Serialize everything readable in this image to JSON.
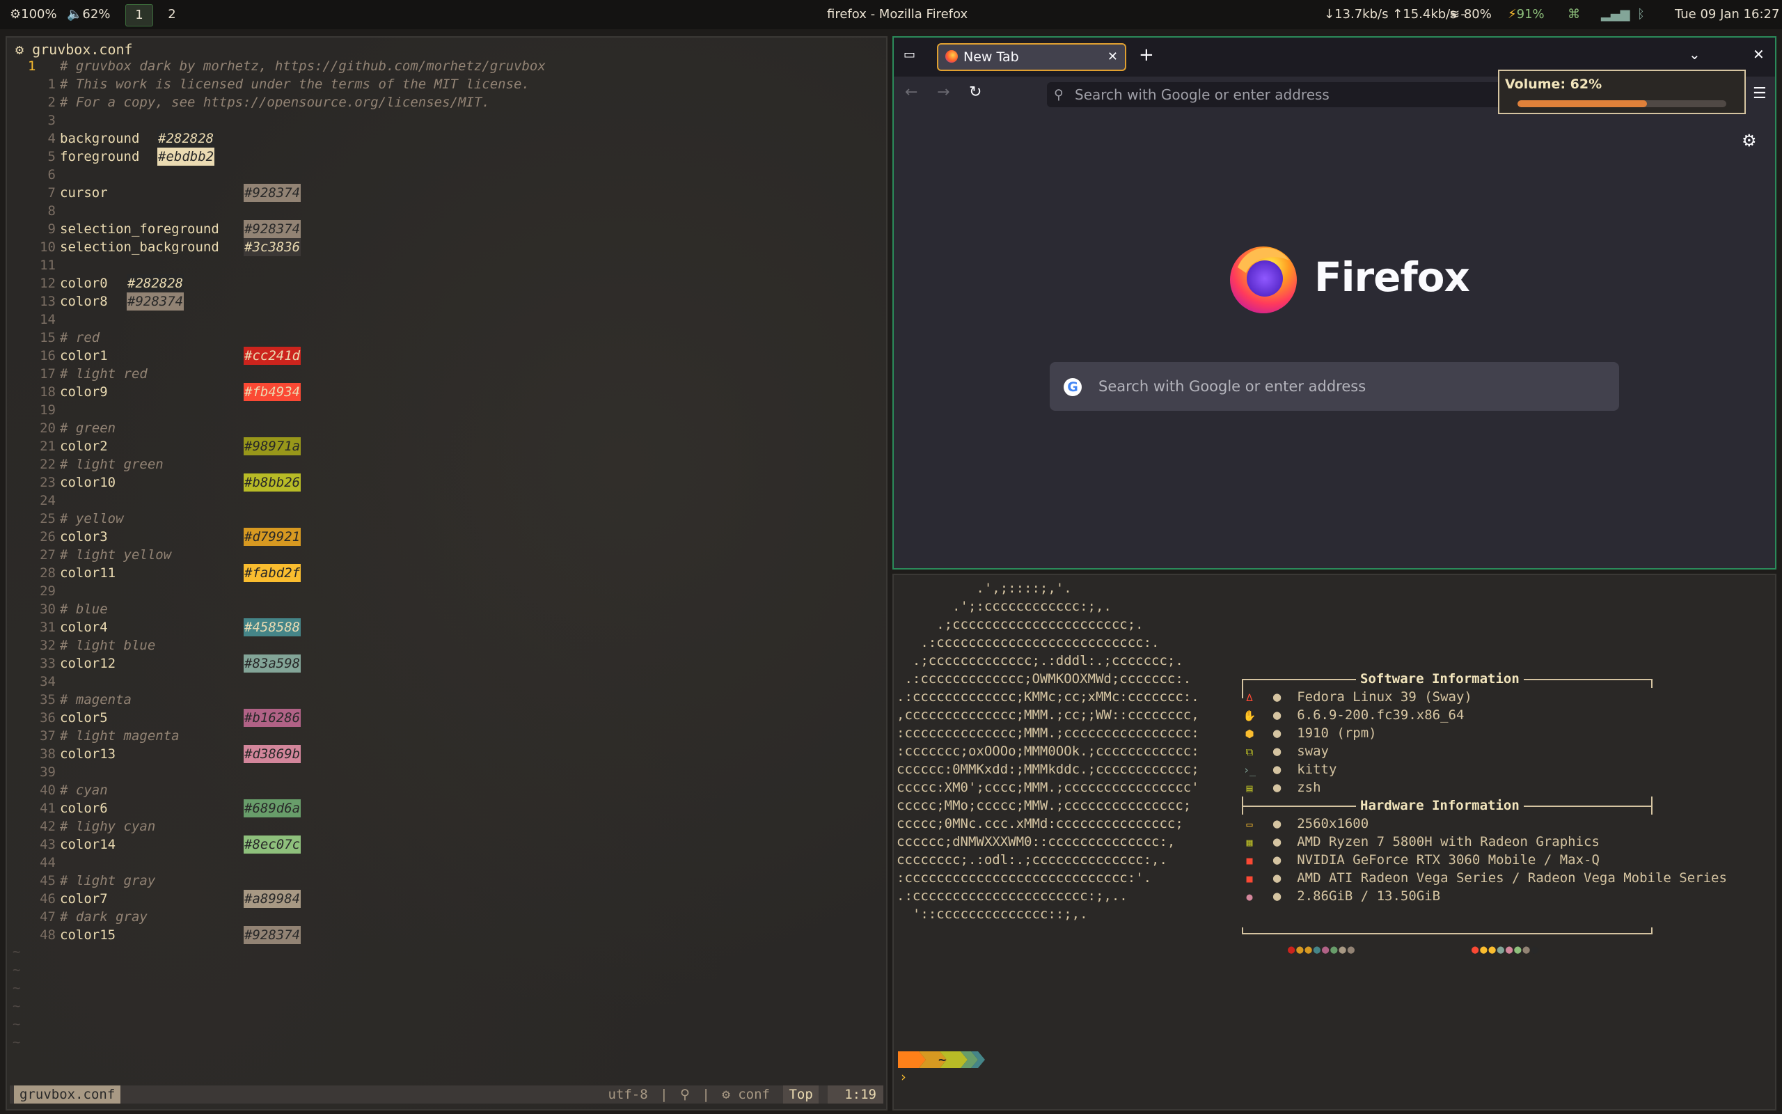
{
  "topbar": {
    "brightness": "100%",
    "volume": "62%",
    "workspaces": [
      "1",
      "2"
    ],
    "window_title": "firefox - Mozilla Firefox",
    "network_speed": "↓13.7kb/s ↑15.4kb/s -",
    "wifi": "80%",
    "battery": "91%",
    "clock": "Tue 09 Jan 16:27"
  },
  "editor": {
    "title": "gruvbox.conf",
    "lines": [
      {
        "n": "1",
        "text": "# gruvbox dark by morhetz, https://github.com/morhetz/gruvbox",
        "type": "comment",
        "current": true
      },
      {
        "n": "1",
        "text": "# This work is licensed under the terms of the MIT license.",
        "type": "comment"
      },
      {
        "n": "2",
        "text": "# For a copy, see https://opensource.org/licenses/MIT.",
        "type": "comment"
      },
      {
        "n": "3",
        "text": "",
        "type": "blank"
      },
      {
        "n": "4",
        "key": "background",
        "value": "#282828",
        "col": "near",
        "bg": "#282828",
        "fg": "#ebdbb2"
      },
      {
        "n": "5",
        "key": "foreground",
        "value": "#ebdbb2",
        "col": "near",
        "bg": "#ebdbb2",
        "fg": "#282828"
      },
      {
        "n": "6",
        "text": "",
        "type": "blank"
      },
      {
        "n": "7",
        "key": "cursor",
        "value": "#928374",
        "col": "far",
        "bg": "#928374",
        "fg": "#282828"
      },
      {
        "n": "8",
        "text": "",
        "type": "blank"
      },
      {
        "n": "9",
        "key": "selection_foreground",
        "value": "#928374",
        "col": "far",
        "bg": "#928374",
        "fg": "#282828"
      },
      {
        "n": "10",
        "key": "selection_background",
        "value": "#3c3836",
        "col": "far",
        "bg": "#3c3836",
        "fg": "#ebdbb2"
      },
      {
        "n": "11",
        "text": "",
        "type": "blank"
      },
      {
        "n": "12",
        "key": "color0",
        "value": "#282828",
        "col": "mid",
        "bg": "#282828",
        "fg": "#ebdbb2"
      },
      {
        "n": "13",
        "key": "color8",
        "value": "#928374",
        "col": "mid",
        "bg": "#928374",
        "fg": "#282828"
      },
      {
        "n": "14",
        "text": "",
        "type": "blank"
      },
      {
        "n": "15",
        "text": "# red",
        "type": "comment"
      },
      {
        "n": "16",
        "key": "color1",
        "value": "#cc241d",
        "col": "far",
        "bg": "#cc241d",
        "fg": "#ebdbb2"
      },
      {
        "n": "17",
        "text": "# light red",
        "type": "comment"
      },
      {
        "n": "18",
        "key": "color9",
        "value": "#fb4934",
        "col": "far",
        "bg": "#fb4934",
        "fg": "#ebdbb2"
      },
      {
        "n": "19",
        "text": "",
        "type": "blank"
      },
      {
        "n": "20",
        "text": "# green",
        "type": "comment"
      },
      {
        "n": "21",
        "key": "color2",
        "value": "#98971a",
        "col": "far",
        "bg": "#98971a",
        "fg": "#282828"
      },
      {
        "n": "22",
        "text": "# light green",
        "type": "comment"
      },
      {
        "n": "23",
        "key": "color10",
        "value": "#b8bb26",
        "col": "far",
        "bg": "#b8bb26",
        "fg": "#282828"
      },
      {
        "n": "24",
        "text": "",
        "type": "blank"
      },
      {
        "n": "25",
        "text": "# yellow",
        "type": "comment"
      },
      {
        "n": "26",
        "key": "color3",
        "value": "#d79921",
        "col": "far",
        "bg": "#d79921",
        "fg": "#282828"
      },
      {
        "n": "27",
        "text": "# light yellow",
        "type": "comment"
      },
      {
        "n": "28",
        "key": "color11",
        "value": "#fabd2f",
        "col": "far",
        "bg": "#fabd2f",
        "fg": "#282828"
      },
      {
        "n": "29",
        "text": "",
        "type": "blank"
      },
      {
        "n": "30",
        "text": "# blue",
        "type": "comment"
      },
      {
        "n": "31",
        "key": "color4",
        "value": "#458588",
        "col": "far",
        "bg": "#458588",
        "fg": "#ebdbb2"
      },
      {
        "n": "32",
        "text": "# light blue",
        "type": "comment"
      },
      {
        "n": "33",
        "key": "color12",
        "value": "#83a598",
        "col": "far",
        "bg": "#83a598",
        "fg": "#282828"
      },
      {
        "n": "34",
        "text": "",
        "type": "blank"
      },
      {
        "n": "35",
        "text": "# magenta",
        "type": "comment"
      },
      {
        "n": "36",
        "key": "color5",
        "value": "#b16286",
        "col": "far",
        "bg": "#b16286",
        "fg": "#282828"
      },
      {
        "n": "37",
        "text": "# light magenta",
        "type": "comment"
      },
      {
        "n": "38",
        "key": "color13",
        "value": "#d3869b",
        "col": "far",
        "bg": "#d3869b",
        "fg": "#282828"
      },
      {
        "n": "39",
        "text": "",
        "type": "blank"
      },
      {
        "n": "40",
        "text": "# cyan",
        "type": "comment"
      },
      {
        "n": "41",
        "key": "color6",
        "value": "#689d6a",
        "col": "far",
        "bg": "#689d6a",
        "fg": "#282828"
      },
      {
        "n": "42",
        "text": "# lighy cyan",
        "type": "comment"
      },
      {
        "n": "43",
        "key": "color14",
        "value": "#8ec07c",
        "col": "far",
        "bg": "#8ec07c",
        "fg": "#282828"
      },
      {
        "n": "44",
        "text": "",
        "type": "blank"
      },
      {
        "n": "45",
        "text": "# light gray",
        "type": "comment"
      },
      {
        "n": "46",
        "key": "color7",
        "value": "#a89984",
        "col": "far",
        "bg": "#a89984",
        "fg": "#282828"
      },
      {
        "n": "47",
        "text": "# dark gray",
        "type": "comment"
      },
      {
        "n": "48",
        "key": "color15",
        "value": "#928374",
        "col": "far",
        "bg": "#928374",
        "fg": "#282828"
      }
    ],
    "status": {
      "filename": "gruvbox.conf",
      "encoding": "utf-8",
      "separator": "|",
      "filetype": "conf",
      "scroll": "Top",
      "position": "1:19"
    }
  },
  "firefox": {
    "tab_title": "New Tab",
    "url_placeholder": "Search with Google or enter address",
    "brand": "Firefox",
    "search_placeholder": "Search with Google or enter address"
  },
  "volume_popup": {
    "label": "Volume: 62%",
    "level": 0.62
  },
  "terminal": {
    "ascii_art": [
      "          .',;::::;,'.",
      "       .';:cccccccccccc:;,.",
      "     .;cccccccccccccccccccccc;.",
      "   .:cccccccccccccccccccccccccc:.",
      "  .;ccccccccccccc;.:dddl:.;ccccccc;.",
      " .:ccccccccccccc;OWMKOOXMWd;ccccccc:.",
      ".:ccccccccccccc;KMMc;cc;xMMc:ccccccc:.",
      ",cccccccccccccc;MMM.;cc;;WW::cccccccc,",
      ":cccccccccccccc;MMM.;cccccccccccccccc:",
      ":ccccccc;oxOOOo;MMM0OOk.;cccccccccccc:",
      "cccccc:0MMKxdd:;MMMkddc.;cccccccccccc;",
      "ccccc:XM0';cccc;MMM.;cccccccccccccccc'",
      "ccccc;MMo;ccccc;MMW.;ccccccccccccccc;",
      "ccccc;0MNc.ccc.xMMd:ccccccccccccccc;",
      "cccccc;dNMWXXXWM0::cccccccccccccc:,",
      "cccccccc;.:odl:.;cccccccccccccc:,.",
      ":cccccccccccccccccccccccccccc:'.",
      ".:cccccccccccccccccccccc:;,..",
      "  '::cccccccccccccc::;,."
    ],
    "software_title": "Software Information",
    "software": [
      {
        "icon": "fedora-icon",
        "glyph": "∆",
        "color": "#fb4934",
        "text": "Fedora Linux 39 (Sway)"
      },
      {
        "icon": "kernel-icon",
        "glyph": "✋",
        "color": "#fe8019",
        "text": "6.6.9-200.fc39.x86_64"
      },
      {
        "icon": "package-icon",
        "glyph": "⬢",
        "color": "#fabd2f",
        "text": "1910 (rpm)"
      },
      {
        "icon": "window-manager-icon",
        "glyph": "⧉",
        "color": "#b8bb26",
        "text": "sway"
      },
      {
        "icon": "terminal-icon",
        "glyph": "›_",
        "color": "#83a598",
        "text": "kitty"
      },
      {
        "icon": "shell-icon",
        "glyph": "▤",
        "color": "#b8bb26",
        "text": "zsh"
      }
    ],
    "hardware_title": "Hardware Information",
    "hardware": [
      {
        "icon": "display-icon",
        "glyph": "▭",
        "color": "#fabd2f",
        "text": "2560x1600"
      },
      {
        "icon": "cpu-icon",
        "glyph": "▦",
        "color": "#b8bb26",
        "text": "AMD Ryzen 7 5800H with Radeon Graphics"
      },
      {
        "icon": "gpu-icon",
        "glyph": "■",
        "color": "#fb4934",
        "text": "NVIDIA GeForce RTX 3060 Mobile / Max-Q"
      },
      {
        "icon": "gpu-icon",
        "glyph": "■",
        "color": "#fb4934",
        "text": "AMD ATI Radeon Vega Series / Radeon Vega Mobile Series"
      },
      {
        "icon": "memory-icon",
        "glyph": "●",
        "color": "#d3869b",
        "text": "2.86GiB / 13.50GiB"
      }
    ],
    "palette_normal": [
      "#cc241d",
      "#d79921",
      "#d79921",
      "#458588",
      "#b16286",
      "#689d6a",
      "#a89984",
      "#928374"
    ],
    "palette_bright": [
      "#fb4934",
      "#fabd2f",
      "#fabd2f",
      "#83a598",
      "#d3869b",
      "#8ec07c",
      "#928374",
      "#282828"
    ],
    "prompt_dir": "~",
    "prompt_caret": "›"
  }
}
